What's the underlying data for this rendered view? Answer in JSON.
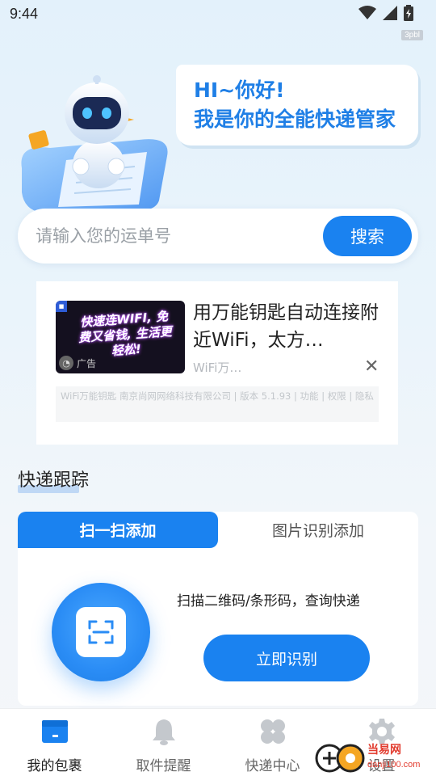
{
  "status_bar": {
    "time": "9:44",
    "watermark": "3pbl"
  },
  "greeting": {
    "line1": "HI~你好!",
    "line2": "我是你的全能快递管家"
  },
  "search": {
    "placeholder": "请输入您的运单号",
    "button_label": "搜索"
  },
  "ad": {
    "image_text": "快速连WIFI, 免费又省钱, 生活更轻松!",
    "tag_label": "广告",
    "title": "用万能钥匙自动连接附近WiFi，太方…",
    "source": "WiFi万…",
    "footer": "WiFi万能钥匙 南京尚网网络科技有限公司 | 版本 5.1.93 | 功能 | 权限 | 隐私"
  },
  "tracking": {
    "section_title": "快递跟踪",
    "tabs": [
      {
        "label": "扫一扫添加",
        "active": true
      },
      {
        "label": "图片识别添加",
        "active": false
      }
    ],
    "scan_description": "扫描二维码/条形码，查询快递",
    "scan_button_label": "立即识别"
  },
  "bottom_nav": {
    "items": [
      {
        "label": "我的包裹",
        "icon": "package-icon",
        "active": true
      },
      {
        "label": "取件提醒",
        "icon": "bell-icon",
        "active": false
      },
      {
        "label": "快递中心",
        "icon": "clover-grid-icon",
        "active": false
      },
      {
        "label": "设置",
        "icon": "gear-icon",
        "active": false
      }
    ]
  },
  "overlay_watermark": {
    "name": "当易网",
    "url": "danji100.com"
  },
  "colors": {
    "accent": "#1a82f0",
    "greeting_text": "#1f7fe6",
    "background": "#e3f1fb"
  }
}
